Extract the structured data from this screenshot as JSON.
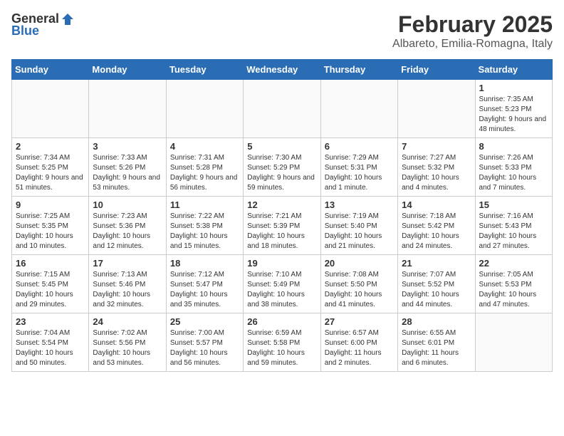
{
  "logo": {
    "general": "General",
    "blue": "Blue"
  },
  "title": {
    "month_year": "February 2025",
    "location": "Albareto, Emilia-Romagna, Italy"
  },
  "weekdays": [
    "Sunday",
    "Monday",
    "Tuesday",
    "Wednesday",
    "Thursday",
    "Friday",
    "Saturday"
  ],
  "weeks": [
    [
      {
        "day": "",
        "info": ""
      },
      {
        "day": "",
        "info": ""
      },
      {
        "day": "",
        "info": ""
      },
      {
        "day": "",
        "info": ""
      },
      {
        "day": "",
        "info": ""
      },
      {
        "day": "",
        "info": ""
      },
      {
        "day": "1",
        "info": "Sunrise: 7:35 AM\nSunset: 5:23 PM\nDaylight: 9 hours and 48 minutes."
      }
    ],
    [
      {
        "day": "2",
        "info": "Sunrise: 7:34 AM\nSunset: 5:25 PM\nDaylight: 9 hours and 51 minutes."
      },
      {
        "day": "3",
        "info": "Sunrise: 7:33 AM\nSunset: 5:26 PM\nDaylight: 9 hours and 53 minutes."
      },
      {
        "day": "4",
        "info": "Sunrise: 7:31 AM\nSunset: 5:28 PM\nDaylight: 9 hours and 56 minutes."
      },
      {
        "day": "5",
        "info": "Sunrise: 7:30 AM\nSunset: 5:29 PM\nDaylight: 9 hours and 59 minutes."
      },
      {
        "day": "6",
        "info": "Sunrise: 7:29 AM\nSunset: 5:31 PM\nDaylight: 10 hours and 1 minute."
      },
      {
        "day": "7",
        "info": "Sunrise: 7:27 AM\nSunset: 5:32 PM\nDaylight: 10 hours and 4 minutes."
      },
      {
        "day": "8",
        "info": "Sunrise: 7:26 AM\nSunset: 5:33 PM\nDaylight: 10 hours and 7 minutes."
      }
    ],
    [
      {
        "day": "9",
        "info": "Sunrise: 7:25 AM\nSunset: 5:35 PM\nDaylight: 10 hours and 10 minutes."
      },
      {
        "day": "10",
        "info": "Sunrise: 7:23 AM\nSunset: 5:36 PM\nDaylight: 10 hours and 12 minutes."
      },
      {
        "day": "11",
        "info": "Sunrise: 7:22 AM\nSunset: 5:38 PM\nDaylight: 10 hours and 15 minutes."
      },
      {
        "day": "12",
        "info": "Sunrise: 7:21 AM\nSunset: 5:39 PM\nDaylight: 10 hours and 18 minutes."
      },
      {
        "day": "13",
        "info": "Sunrise: 7:19 AM\nSunset: 5:40 PM\nDaylight: 10 hours and 21 minutes."
      },
      {
        "day": "14",
        "info": "Sunrise: 7:18 AM\nSunset: 5:42 PM\nDaylight: 10 hours and 24 minutes."
      },
      {
        "day": "15",
        "info": "Sunrise: 7:16 AM\nSunset: 5:43 PM\nDaylight: 10 hours and 27 minutes."
      }
    ],
    [
      {
        "day": "16",
        "info": "Sunrise: 7:15 AM\nSunset: 5:45 PM\nDaylight: 10 hours and 29 minutes."
      },
      {
        "day": "17",
        "info": "Sunrise: 7:13 AM\nSunset: 5:46 PM\nDaylight: 10 hours and 32 minutes."
      },
      {
        "day": "18",
        "info": "Sunrise: 7:12 AM\nSunset: 5:47 PM\nDaylight: 10 hours and 35 minutes."
      },
      {
        "day": "19",
        "info": "Sunrise: 7:10 AM\nSunset: 5:49 PM\nDaylight: 10 hours and 38 minutes."
      },
      {
        "day": "20",
        "info": "Sunrise: 7:08 AM\nSunset: 5:50 PM\nDaylight: 10 hours and 41 minutes."
      },
      {
        "day": "21",
        "info": "Sunrise: 7:07 AM\nSunset: 5:52 PM\nDaylight: 10 hours and 44 minutes."
      },
      {
        "day": "22",
        "info": "Sunrise: 7:05 AM\nSunset: 5:53 PM\nDaylight: 10 hours and 47 minutes."
      }
    ],
    [
      {
        "day": "23",
        "info": "Sunrise: 7:04 AM\nSunset: 5:54 PM\nDaylight: 10 hours and 50 minutes."
      },
      {
        "day": "24",
        "info": "Sunrise: 7:02 AM\nSunset: 5:56 PM\nDaylight: 10 hours and 53 minutes."
      },
      {
        "day": "25",
        "info": "Sunrise: 7:00 AM\nSunset: 5:57 PM\nDaylight: 10 hours and 56 minutes."
      },
      {
        "day": "26",
        "info": "Sunrise: 6:59 AM\nSunset: 5:58 PM\nDaylight: 10 hours and 59 minutes."
      },
      {
        "day": "27",
        "info": "Sunrise: 6:57 AM\nSunset: 6:00 PM\nDaylight: 11 hours and 2 minutes."
      },
      {
        "day": "28",
        "info": "Sunrise: 6:55 AM\nSunset: 6:01 PM\nDaylight: 11 hours and 6 minutes."
      },
      {
        "day": "",
        "info": ""
      }
    ]
  ]
}
